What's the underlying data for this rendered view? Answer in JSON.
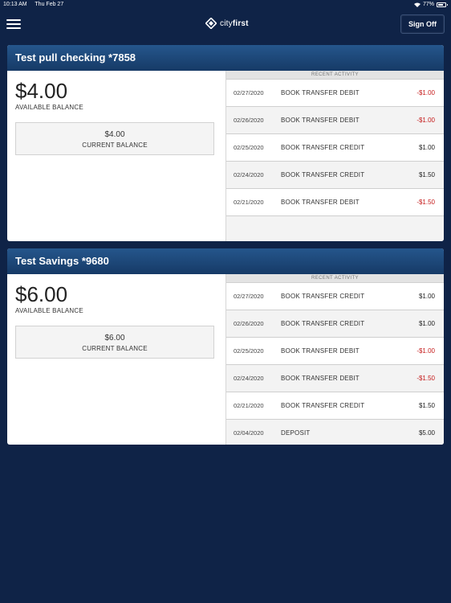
{
  "status": {
    "time": "10:13 AM",
    "date": "Thu Feb 27",
    "battery": "77%",
    "battery_level": 0.77
  },
  "header": {
    "logo_text_a": "city",
    "logo_text_b": "first",
    "sign_off_label": "Sign Off"
  },
  "accounts": [
    {
      "name": "Test pull checking *7858",
      "available_amount": "$4.00",
      "available_label": "AVAILABLE BALANCE",
      "current_amount": "$4.00",
      "current_label": "CURRENT BALANCE",
      "activity_title": "RECENT ACTIVITY",
      "transactions": [
        {
          "date": "02/27/2020",
          "desc": "BOOK TRANSFER DEBIT",
          "amount": "-$1.00",
          "negative": true
        },
        {
          "date": "02/26/2020",
          "desc": "BOOK TRANSFER DEBIT",
          "amount": "-$1.00",
          "negative": true
        },
        {
          "date": "02/25/2020",
          "desc": "BOOK TRANSFER CREDIT",
          "amount": "$1.00",
          "negative": false
        },
        {
          "date": "02/24/2020",
          "desc": "BOOK TRANSFER CREDIT",
          "amount": "$1.50",
          "negative": false
        },
        {
          "date": "02/21/2020",
          "desc": "BOOK TRANSFER DEBIT",
          "amount": "-$1.50",
          "negative": true
        }
      ]
    },
    {
      "name": "Test Savings *9680",
      "available_amount": "$6.00",
      "available_label": "AVAILABLE BALANCE",
      "current_amount": "$6.00",
      "current_label": "CURRENT BALANCE",
      "activity_title": "RECENT ACTIVITY",
      "transactions": [
        {
          "date": "02/27/2020",
          "desc": "BOOK TRANSFER CREDIT",
          "amount": "$1.00",
          "negative": false
        },
        {
          "date": "02/26/2020",
          "desc": "BOOK TRANSFER CREDIT",
          "amount": "$1.00",
          "negative": false
        },
        {
          "date": "02/25/2020",
          "desc": "BOOK TRANSFER DEBIT",
          "amount": "-$1.00",
          "negative": true
        },
        {
          "date": "02/24/2020",
          "desc": "BOOK TRANSFER DEBIT",
          "amount": "-$1.50",
          "negative": true
        },
        {
          "date": "02/21/2020",
          "desc": "BOOK TRANSFER CREDIT",
          "amount": "$1.50",
          "negative": false
        },
        {
          "date": "02/04/2020",
          "desc": "DEPOSIT",
          "amount": "$5.00",
          "negative": false
        }
      ]
    }
  ],
  "colors": {
    "background": "#0f2347",
    "header_gradient_top": "#25568c",
    "header_gradient_bottom": "#163a66",
    "negative_amount": "#c51b1b"
  }
}
